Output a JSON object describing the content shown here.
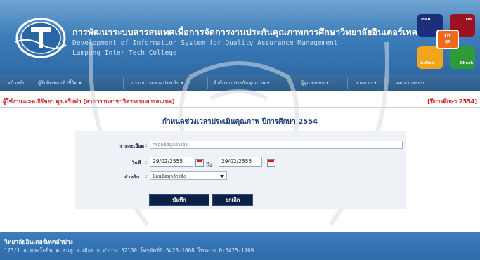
{
  "header": {
    "title_th": "การพัฒนาระบบสารสนเทศเพื่อการจัดการงานประกันคุณภาพการศึกษาวิทยาลัยอินเตอร์เทคลำปาง",
    "title_en_line1": "Development of Information System for Quality Assurance Management",
    "title_en_line2": "Lampang Inter-Tech College",
    "pdca": {
      "plan": "Plan",
      "do": "Do",
      "action": "Action",
      "check": "Check",
      "center_line1": "LIT",
      "center_line2": "QA"
    }
  },
  "nav": {
    "items": [
      {
        "label": "หน้าหลัก",
        "has_dropdown": false
      },
      {
        "label": "ผู้รับผิดชอบตัวชี้วัด",
        "has_dropdown": true
      },
      {
        "label": "กรรมการตรวจประเมิน",
        "has_dropdown": true
      },
      {
        "label": "สำนักงานประกันคุณภาพ",
        "has_dropdown": true
      },
      {
        "label": "ผู้ดูแลระบบ",
        "has_dropdown": true
      },
      {
        "label": "รายงาน",
        "has_dropdown": true
      },
      {
        "label": "ออกจากระบบ",
        "has_dropdown": false
      }
    ]
  },
  "user_bar": {
    "user_text": "ผู้ใช้งาน=>อ.จิรัชยา  ตุงเครือคำ  [สาขางานสาขาวิชาระบบสารสนเทศ]",
    "year_text": "[ปีการศึกษา   2554]"
  },
  "form": {
    "title": "กำหนดช่วงเวลาประเมินคุณภาพ ปีการศึกษา 2554",
    "detail_label": "รายละเอียด",
    "detail_placeholder": "กรอกข้อมูลอ้างอิง",
    "date_label": "วันที่",
    "date_from": "29/02/2555",
    "to_label": "ถึง",
    "date_to": "29/02/2555",
    "for_label": "สำหรับ",
    "for_selected": "ป้อนข้อมูลอ้างอิง",
    "colon": ":",
    "save_button": "บันทึก",
    "cancel_button": "ยกเลิก"
  },
  "footer": {
    "college_name": "วิทยาลัยอินเตอร์เทคลำปาง",
    "address": "173/1 ถ.พหลโยธิน ต.ชมพู อ.เมือง จ.ลำปาง 52100 โทรศัพท์0-5423-1068 โทรสาร 0-5425-1209"
  },
  "colors": {
    "header_blue": "#3b7bb8",
    "nav_blue": "#2d5c8a",
    "user_red": "#cc1f1f",
    "title_navy": "#1b3f7a",
    "button_navy": "#0c2145",
    "footer_blue": "#2d6aa8"
  }
}
